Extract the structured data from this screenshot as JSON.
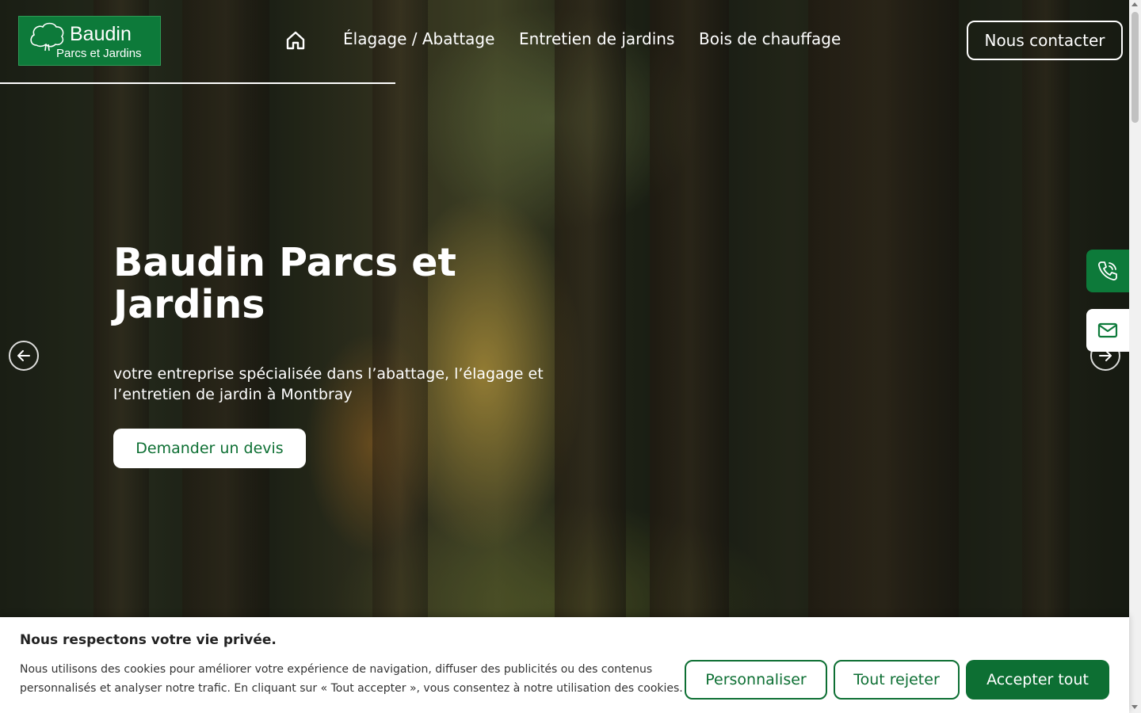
{
  "header": {
    "logo": {
      "brand": "Baudin",
      "sub": "Parcs et Jardins"
    },
    "nav": [
      "Élagage / Abattage",
      "Entretien de jardins",
      "Bois de chauffage"
    ],
    "contact_label": "Nous contacter"
  },
  "hero": {
    "title": "Baudin Parcs et Jardins",
    "subtitle": "votre entreprise spécialisée dans l’abattage, l’élagage et l’entretien de jardin à Montbray",
    "cta": "Demander un devis"
  },
  "cookie": {
    "title": "Nous respectons votre vie privée.",
    "text": "Nous utilisons des cookies pour améliorer votre expérience de navigation, diffuser des publicités ou des contenus personnalisés et analyser notre trafic. En cliquant sur « Tout accepter », vous consentez à notre utilisation des cookies.",
    "customize": "Personnaliser",
    "reject": "Tout rejeter",
    "accept": "Accepter tout"
  },
  "colors": {
    "brand_green": "#0d7a3a",
    "button_green": "#0d6f33"
  },
  "icons": [
    "tree-icon",
    "home-icon",
    "arrow-left-icon",
    "arrow-right-icon",
    "phone-icon",
    "mail-icon"
  ]
}
